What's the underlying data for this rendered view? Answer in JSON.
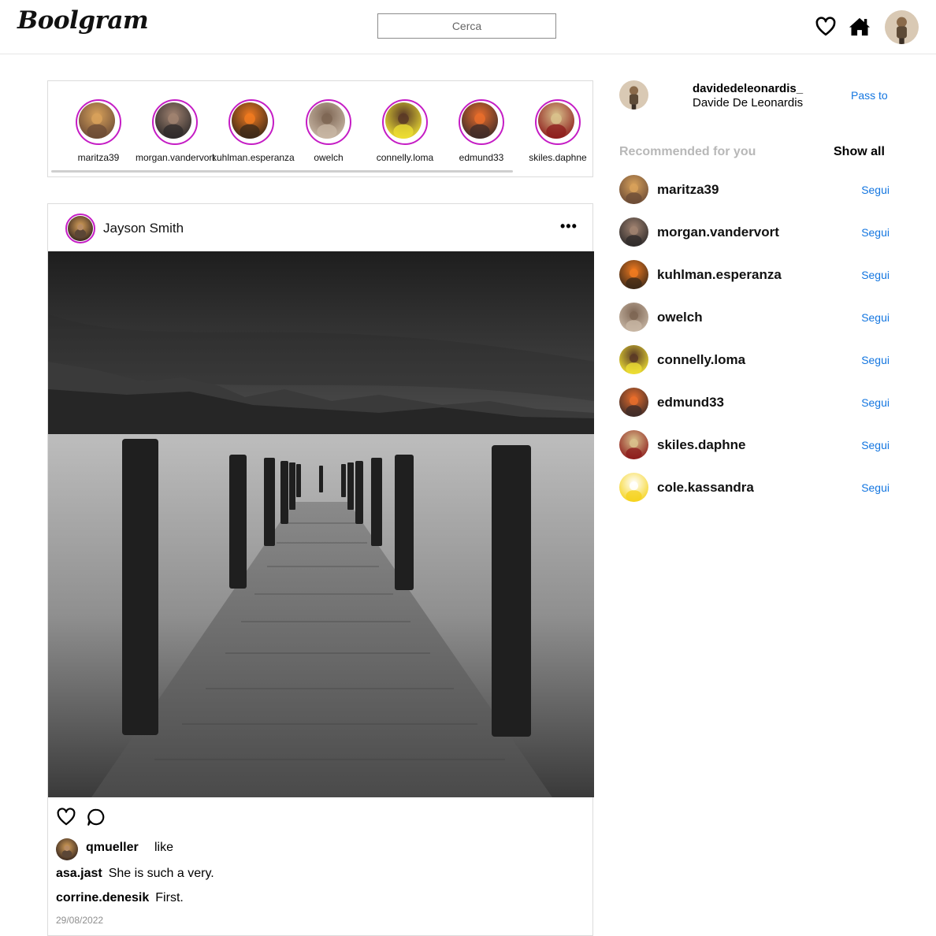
{
  "app": {
    "logo": "Boolgram"
  },
  "header": {
    "search_placeholder": "Cerca",
    "icons": [
      "heart-icon",
      "home-icon",
      "profile-avatar"
    ]
  },
  "stories": [
    {
      "name": "maritza39",
      "tone": [
        "#6b4b36",
        "#d8a15a"
      ]
    },
    {
      "name": "morgan.vandervort",
      "tone": [
        "#2d2a2a",
        "#a08270"
      ]
    },
    {
      "name": "kuhlman.esperanza",
      "tone": [
        "#3a2818",
        "#f07a20"
      ]
    },
    {
      "name": "owelch",
      "tone": [
        "#c9b8a6",
        "#7e6654"
      ]
    },
    {
      "name": "connelly.loma",
      "tone": [
        "#f0e234",
        "#5a3a26"
      ]
    },
    {
      "name": "edmund33",
      "tone": [
        "#3c2b28",
        "#e86d2c"
      ]
    },
    {
      "name": "skiles.daphne",
      "tone": [
        "#8c1b1b",
        "#d9c28c"
      ]
    }
  ],
  "post": {
    "author": "Jayson Smith",
    "more": "•••",
    "liked_by": {
      "user": "qmueller",
      "text": "like"
    },
    "comments": [
      {
        "user": "asa.jast",
        "text": "She is such a very."
      },
      {
        "user": "corrine.denesik",
        "text": "First."
      }
    ],
    "date": "29/08/2022"
  },
  "sidebar": {
    "me": {
      "username": "davidedeleonardis_",
      "name": "Davide De Leonardis",
      "action": "Pass to"
    },
    "recommended_title": "Recommended for you",
    "show_all": "Show all",
    "recommended": [
      {
        "name": "maritza39",
        "action": "Segui",
        "tone": [
          "#6b4b36",
          "#d8a15a"
        ]
      },
      {
        "name": "morgan.vandervort",
        "action": "Segui",
        "tone": [
          "#2d2a2a",
          "#a08270"
        ]
      },
      {
        "name": "kuhlman.esperanza",
        "action": "Segui",
        "tone": [
          "#3a2818",
          "#f07a20"
        ]
      },
      {
        "name": "owelch",
        "action": "Segui",
        "tone": [
          "#c9b8a6",
          "#7e6654"
        ]
      },
      {
        "name": "connelly.loma",
        "action": "Segui",
        "tone": [
          "#f0e234",
          "#5a3a26"
        ]
      },
      {
        "name": "edmund33",
        "action": "Segui",
        "tone": [
          "#3c2b28",
          "#e86d2c"
        ]
      },
      {
        "name": "skiles.daphne",
        "action": "Segui",
        "tone": [
          "#8c1b1b",
          "#d9c28c"
        ]
      },
      {
        "name": "cole.kassandra",
        "action": "Segui",
        "tone": [
          "#f5d21a",
          "#ffffff"
        ]
      }
    ]
  },
  "colors": {
    "story_ring": "#c51dc5",
    "link": "#1476e0",
    "muted": "#b8b8b8"
  }
}
